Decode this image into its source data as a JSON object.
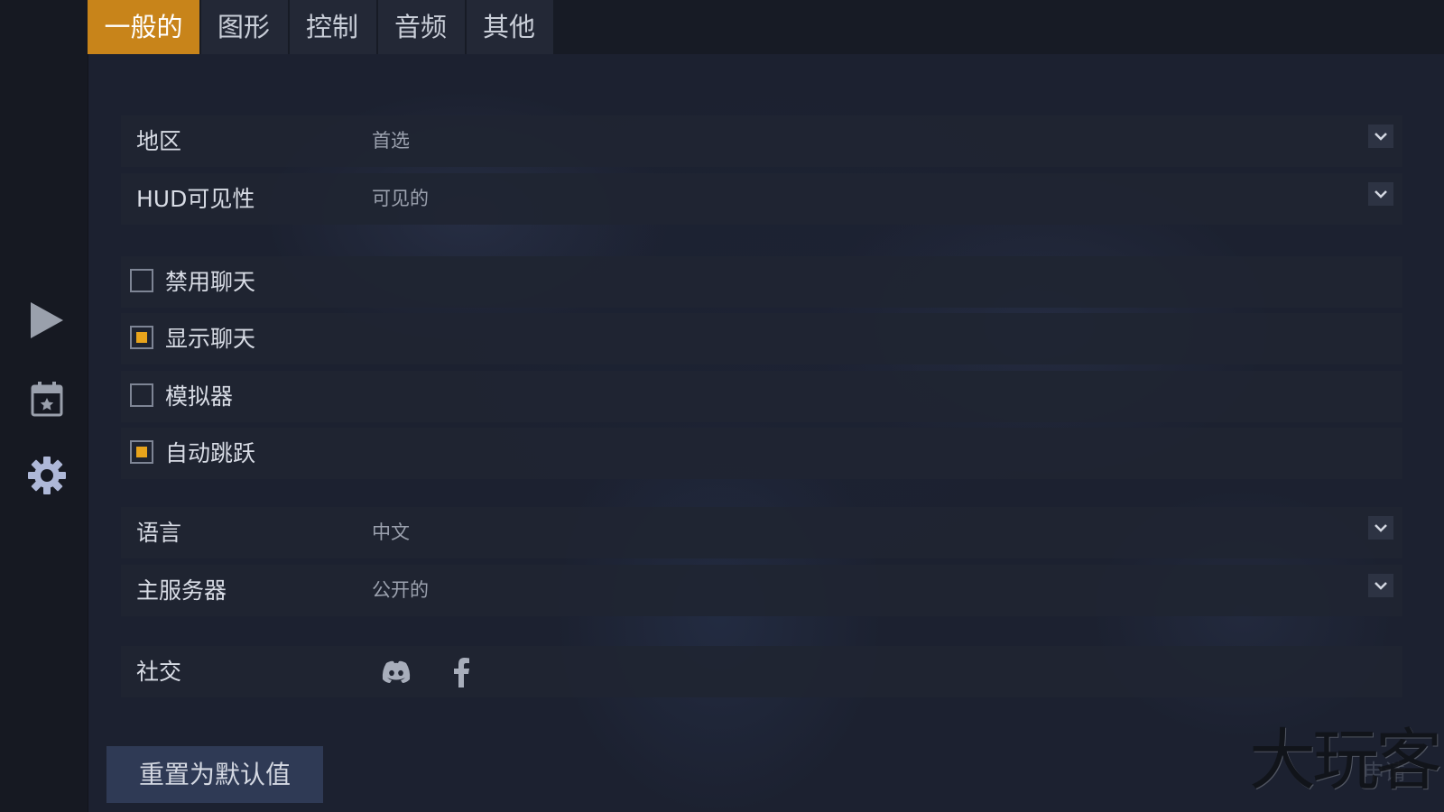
{
  "tabs": [
    {
      "label": "一般的",
      "active": true
    },
    {
      "label": "图形",
      "active": false
    },
    {
      "label": "控制",
      "active": false
    },
    {
      "label": "音频",
      "active": false
    },
    {
      "label": "其他",
      "active": false
    }
  ],
  "rail": {
    "items": [
      {
        "icon": "play-icon"
      },
      {
        "icon": "calendar-star-icon"
      },
      {
        "icon": "gear-icon"
      }
    ]
  },
  "settings": {
    "region": {
      "label": "地区",
      "value": "首选"
    },
    "hud": {
      "label": "HUD可见性",
      "value": "可见的"
    },
    "disable_chat": {
      "label": "禁用聊天",
      "checked": false
    },
    "show_chat": {
      "label": "显示聊天",
      "checked": true
    },
    "emulator": {
      "label": "模拟器",
      "checked": false
    },
    "auto_jump": {
      "label": "自动跳跃",
      "checked": true
    },
    "language": {
      "label": "语言",
      "value": "中文"
    },
    "main_server": {
      "label": "主服务器",
      "value": "公开的"
    },
    "social": {
      "label": "社交",
      "icons": [
        "discord-icon",
        "facebook-icon"
      ]
    }
  },
  "footer": {
    "reset_label": "重置为默认值",
    "apply_label": "申请"
  },
  "watermark": "大玩客",
  "colors": {
    "accent": "#c8841a",
    "check_fill": "#e8a41c",
    "row_bg": "#202532",
    "page_bg": "#171b25"
  }
}
